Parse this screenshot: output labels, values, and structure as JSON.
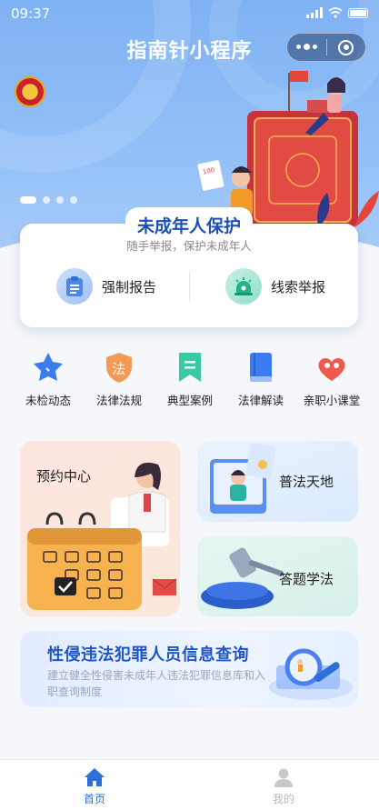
{
  "status_bar": {
    "time": "09:37"
  },
  "header": {
    "title": "指南针小程序"
  },
  "banner": {
    "slides": 4,
    "active_slide": 1,
    "book_label": "100"
  },
  "protect": {
    "title": "未成年人保护",
    "subtitle": "随手举报，保护未成年人",
    "actions": [
      {
        "label": "强制报告",
        "icon": "clipboard-icon"
      },
      {
        "label": "线索举报",
        "icon": "alarm-icon"
      }
    ]
  },
  "categories": [
    {
      "label": "未检动态",
      "icon": "star-icon"
    },
    {
      "label": "法律法规",
      "icon": "law-shield-icon",
      "glyph": "法"
    },
    {
      "label": "典型案例",
      "icon": "bookmark-icon"
    },
    {
      "label": "法律解读",
      "icon": "book-icon"
    },
    {
      "label": "亲职小课堂",
      "icon": "heart-people-icon"
    }
  ],
  "cards": {
    "appointment": "预约中心",
    "law_world": "普法天地",
    "quiz": "答题学法"
  },
  "query": {
    "title": "性侵违法犯罪人员信息查询",
    "description": "建立健全性侵害未成年人违法犯罪信息库和入职查询制度"
  },
  "tabbar": {
    "home": "首页",
    "me": "我的"
  },
  "colors": {
    "primary": "#2f6fd8",
    "hero": "#7fb2f3",
    "title_blue": "#1e4fb7"
  }
}
